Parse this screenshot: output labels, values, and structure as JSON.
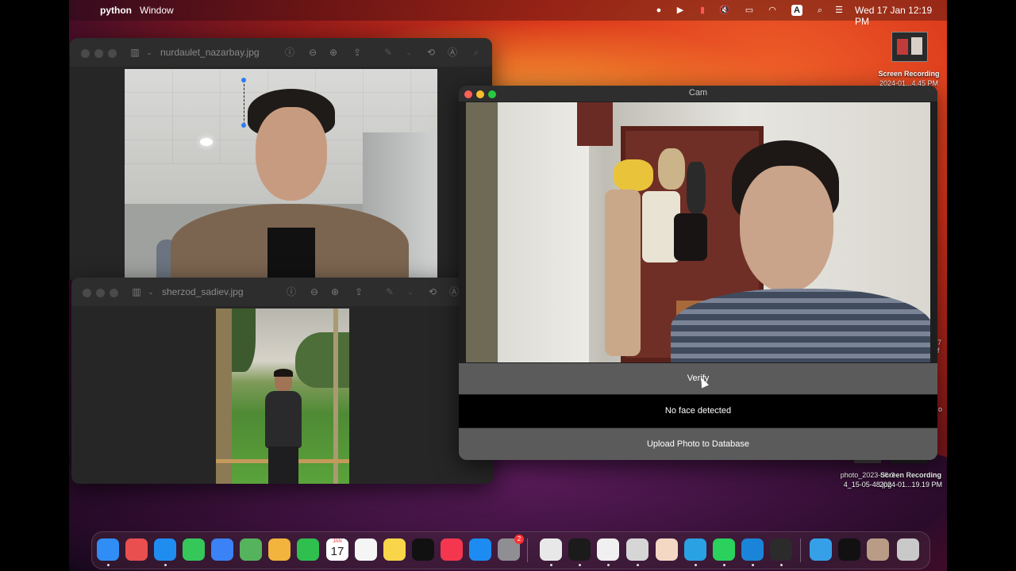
{
  "menubar": {
    "app_name": "python",
    "menu_window": "Window",
    "clock": "Wed 17 Jan  12:19 PM",
    "input_source": "A"
  },
  "desktop": {
    "screen_recording_1": {
      "title": "Screen Recording",
      "subtitle": "2024-01...4.45 PM"
    },
    "photo_file": {
      "title": "photo_2023-06-2",
      "subtitle": "4_15-05-48.jpg"
    },
    "screen_recording_2": {
      "title": "Screen Recording",
      "subtitle": "2024-01...19.19 PM"
    },
    "edge_fragments": [
      "7",
      "f",
      "o"
    ]
  },
  "preview_windows": [
    {
      "title": "nurdaulet_nazarbay.jpg",
      "photo_description": "portrait"
    },
    {
      "title": "sherzod_sadiev.jpg",
      "photo_description": "portrait"
    }
  ],
  "cam_window": {
    "title": "Cam",
    "verify_label": "Verify",
    "status_text": "No face detected",
    "upload_label": "Upload Photo to Database"
  },
  "dock": {
    "calendar_month": "JAN",
    "calendar_day": "17",
    "settings_badge": "2",
    "items": [
      {
        "name": "finder",
        "color": "#2f8df5"
      },
      {
        "name": "launchpad",
        "color": "#e94f4f"
      },
      {
        "name": "safari",
        "color": "#1f8cf0"
      },
      {
        "name": "messages",
        "color": "#35c759"
      },
      {
        "name": "mail",
        "color": "#3a82f6"
      },
      {
        "name": "maps",
        "color": "#56b35d"
      },
      {
        "name": "photos",
        "color": "#f2b43c"
      },
      {
        "name": "facetime",
        "color": "#2fbf4f"
      },
      {
        "name": "calendar",
        "color": "#ffffff"
      },
      {
        "name": "reminders",
        "color": "#f5f5f5"
      },
      {
        "name": "notes",
        "color": "#f8d549"
      },
      {
        "name": "apple-tv",
        "color": "#111111"
      },
      {
        "name": "music",
        "color": "#f5364f"
      },
      {
        "name": "app-store",
        "color": "#1c8cf2"
      },
      {
        "name": "system-settings",
        "color": "#8e8e93"
      },
      {
        "name": "chrome",
        "color": "#e8e8e8"
      },
      {
        "name": "terminal",
        "color": "#1b1b1b"
      },
      {
        "name": "textedit",
        "color": "#f0f0f0"
      },
      {
        "name": "preview",
        "color": "#d6d6d6"
      },
      {
        "name": "r-app",
        "color": "#f4d8c4"
      },
      {
        "name": "telegram",
        "color": "#2aa1e2"
      },
      {
        "name": "whatsapp",
        "color": "#2ad15c"
      },
      {
        "name": "vscode",
        "color": "#1a84d8"
      },
      {
        "name": "python-launcher",
        "color": "#2b2b2b"
      },
      {
        "name": "downloads-folder",
        "color": "#35a0e8"
      },
      {
        "name": "recent-window",
        "color": "#111111"
      },
      {
        "name": "recent-photo",
        "color": "#b89c86"
      },
      {
        "name": "trash",
        "color": "#c9c9c9"
      }
    ]
  }
}
